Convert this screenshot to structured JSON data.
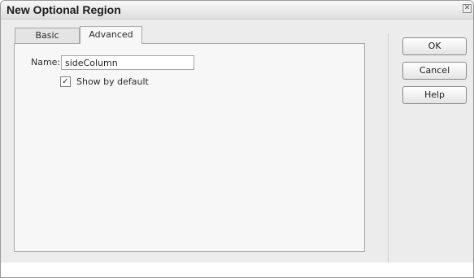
{
  "window": {
    "title": "New Optional Region",
    "close_icon": "close-icon"
  },
  "tabs": [
    {
      "label": "Basic",
      "selected": false
    },
    {
      "label": "Advanced",
      "selected": true
    }
  ],
  "form": {
    "name_label": "Name:",
    "name_value": "sideColumn",
    "show_default_label": "Show by default",
    "show_default_checked": true,
    "checkmark_icon": "check-icon"
  },
  "buttons": {
    "ok": "OK",
    "cancel": "Cancel",
    "help": "Help"
  }
}
